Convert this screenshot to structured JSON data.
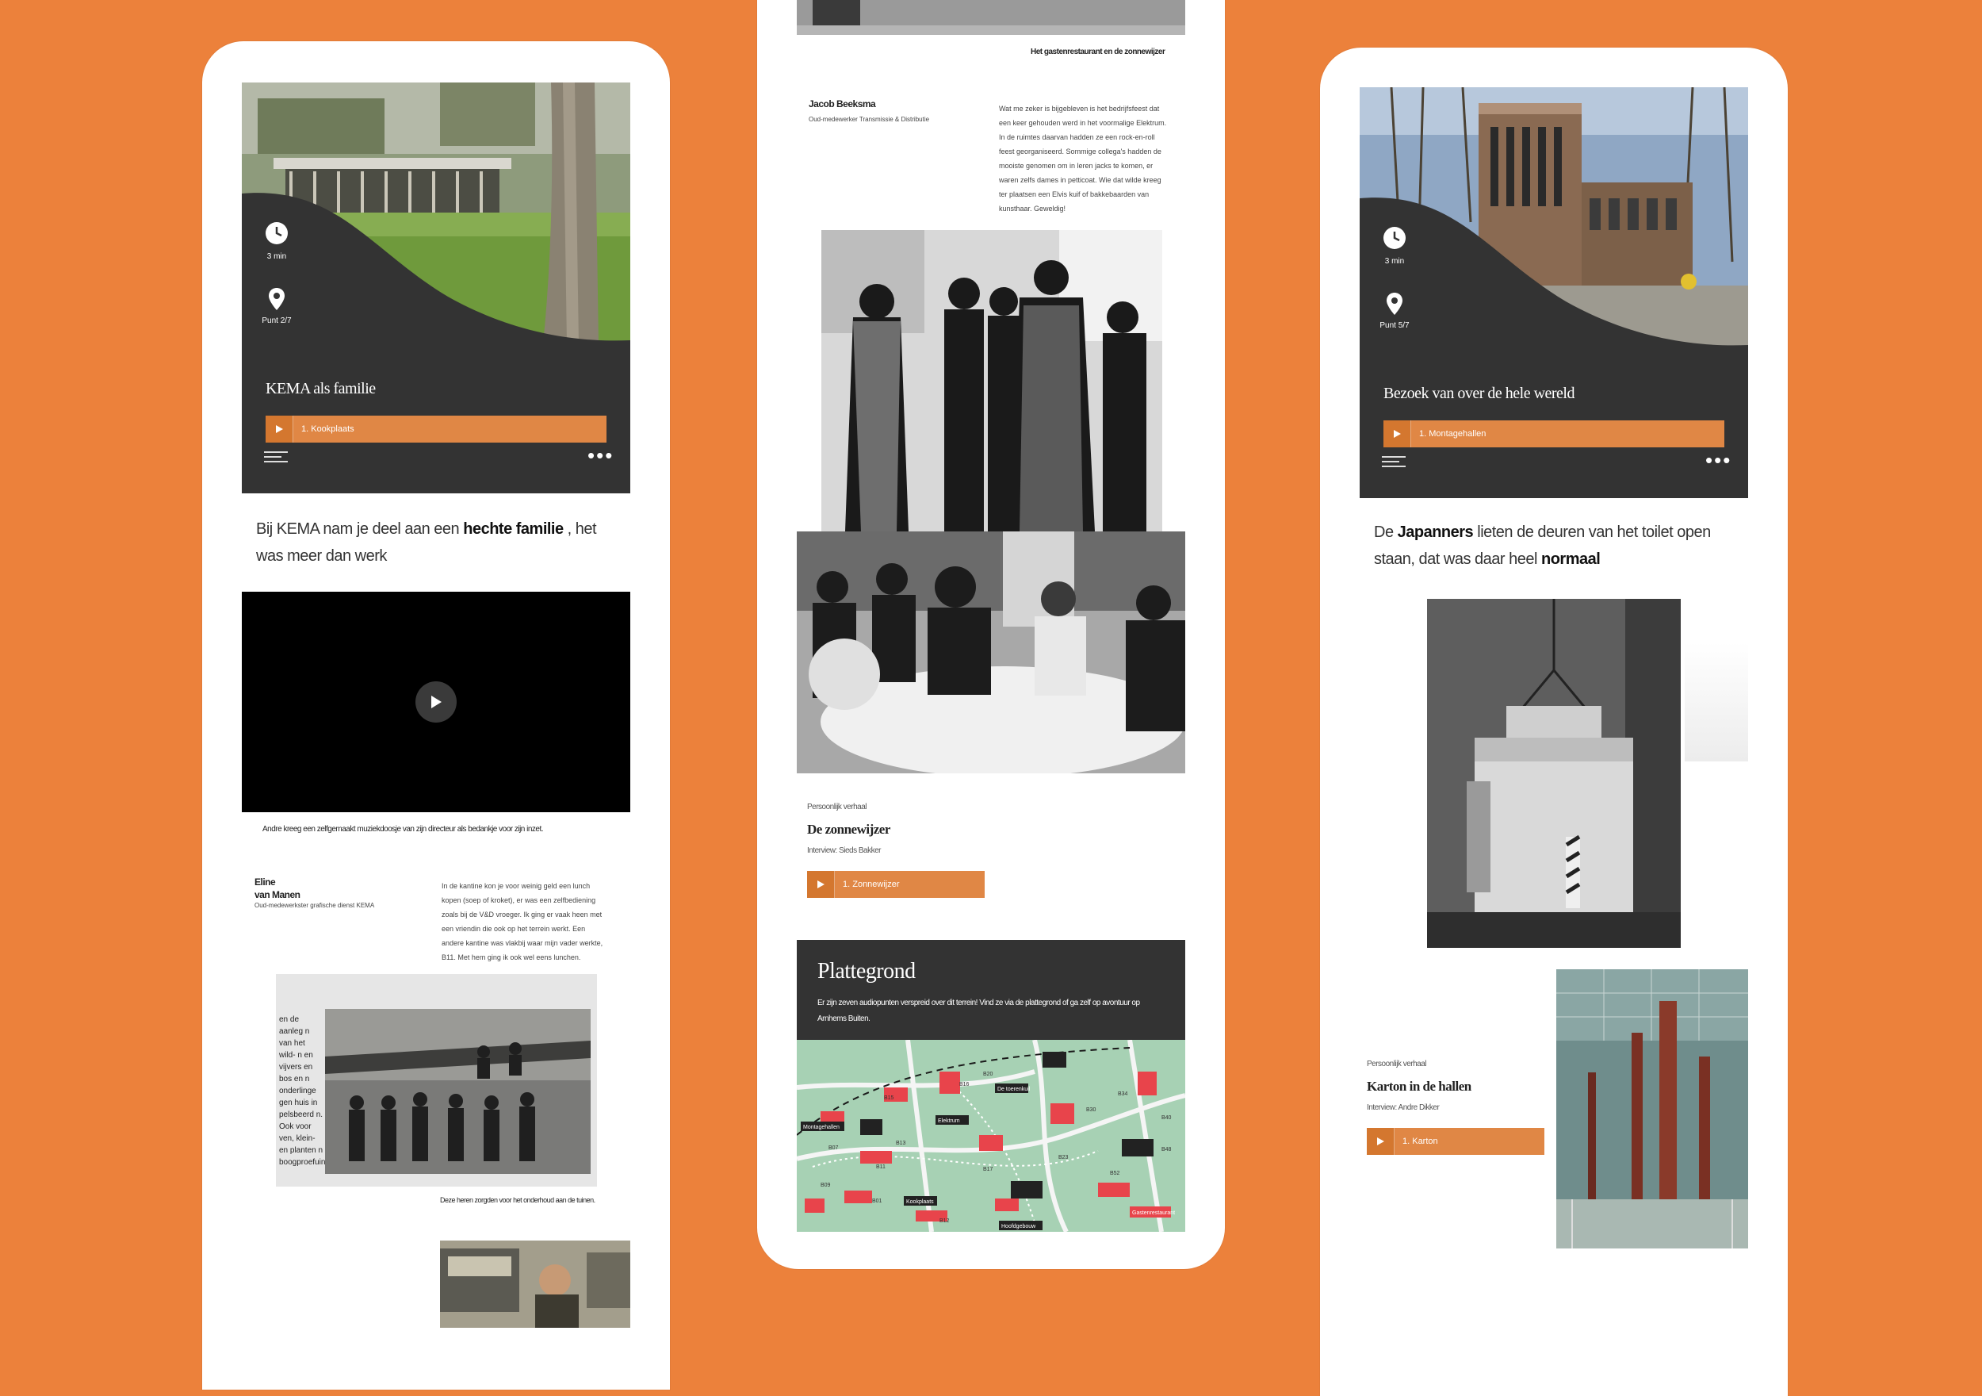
{
  "left": {
    "meta_time": "3 min",
    "meta_point": "Punt 2/7",
    "title": "KEMA als familie",
    "audio_label": "1. Kookplaats",
    "quote_pre": "Bij KEMA nam je deel aan een ",
    "quote_bold": "hechte familie",
    "quote_post": " , het was meer dan werk",
    "video_caption": "Andre kreeg een zelfgemaakt muziekdoosje van zijn directeur als bedankje voor zijn inzet.",
    "person_name_1": "Eline",
    "person_name_2": "van Manen",
    "person_role": "Oud-medewerkster grafische dienst KEMA",
    "story": "In de kantine kon je voor weinig geld een lunch kopen (soep of kroket), er was een zelfbediening zoals bij de V&D vroeger. Ik ging er vaak heen met een vriendin die ook op het terrein werkt. Een andere kantine was vlakbij waar mijn vader werkte, B11. Met hem ging ik ook wel eens lunchen.",
    "photo_side_text": "en de aanleg n van het wild- n en vijvers en bos en n onderlinge gen huis in pelsbeerd n. Ook voor ven, klein- en planten n boogproefuin.",
    "photo_caption": "Deze heren zorgden voor het onderhoud aan de tuinen."
  },
  "middle": {
    "top_caption": "Het gastenrestaurant en de zonnewijzer",
    "person_name": "Jacob Beeksma",
    "person_role": "Oud-medewerker Transmissie & Distributie",
    "story": "Wat me zeker is bijgebleven is het bedrijfsfeest dat een keer gehouden werd in het voormalige Elektrum. In de ruimtes daarvan hadden ze een rock-en-roll feest georganiseerd. Sommige collega's hadden de mooiste genomen om in leren jacks te komen, er waren zelfs dames in petticoat. Wie dat wilde kreeg ter plaatsen een Elvis kuif of bakkebaarden van kunsthaar. Geweldig!",
    "story_kicker": "Persoonlijk verhaal",
    "story_title": "De zonnewijzer",
    "story_interview": "Interview: Sieds Bakker",
    "audio_label": "1. Zonnewijzer",
    "map_title": "Plattegrond",
    "map_text": "Er zijn zeven audiopunten verspreid over dit terrein! Vind ze via de plattegrond of ga zelf op avontuur op Arnhems Buiten.",
    "map_labels": [
      "Montagehallen",
      "Elektrum",
      "De toerenkuil",
      "Kookplaats",
      "Hoofdgebouw",
      "Zonnewijzer",
      "Gastenrestaurant"
    ],
    "map_codes": [
      "B20",
      "B16",
      "B15",
      "B13",
      "B11",
      "B07",
      "B09",
      "B01",
      "B12",
      "B17",
      "B23",
      "B30",
      "B34",
      "B40",
      "B48",
      "B52"
    ]
  },
  "right": {
    "meta_time": "3 min",
    "meta_point": "Punt 5/7",
    "title": "Bezoek van over de hele wereld",
    "audio_label": "1. Montagehallen",
    "quote_pre": "De ",
    "quote_bold1": "Japanners",
    "quote_mid": " lieten de deuren van het toilet open staan, dat was daar heel ",
    "quote_bold2": "normaal",
    "story_kicker": "Persoonlijk verhaal",
    "story_title": "Karton in de hallen",
    "story_interview": "Interview: Andre Dikker",
    "audio_label_2": "1. Karton"
  },
  "colors": {
    "background": "#ec813b",
    "accent": "#e08745",
    "dark": "#333333"
  },
  "icons": [
    "clock-icon",
    "location-pin-icon",
    "play-icon",
    "text-lines-icon",
    "more-dots-icon"
  ]
}
